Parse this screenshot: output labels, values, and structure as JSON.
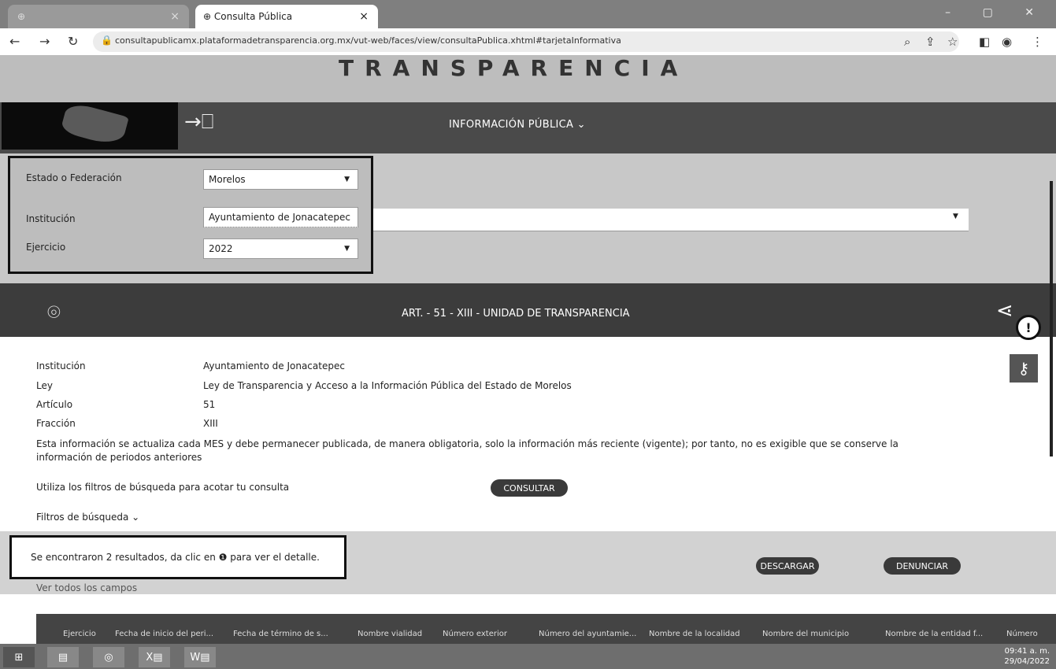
{
  "browser": {
    "tabs": [
      {
        "label": "",
        "active": false
      },
      {
        "label": "Consulta Pública",
        "active": true
      }
    ],
    "tab_close": "×",
    "url": "consultapublicamx.plataformadetransparencia.org.mx/vut-web/faces/view/consultaPublica.xhtml#tarjetaInformativa"
  },
  "header": {
    "logo_text": "TRANSPARENCIA",
    "nav_label": "INFORMACIÓN PÚBLICA ⌄"
  },
  "filters": {
    "state_label": "Estado o Federación",
    "state_value": "Morelos",
    "institution_label": "Institución",
    "institution_value": "Ayuntamiento de Jonacatepec",
    "year_label": "Ejercicio",
    "year_value": "2022"
  },
  "article": {
    "title": "ART. - 51 - XIII - UNIDAD DE TRANSPARENCIA"
  },
  "details": {
    "rows": [
      {
        "label": "Institución",
        "value": "Ayuntamiento de Jonacatepec"
      },
      {
        "label": "Ley",
        "value": "Ley de Transparencia y Acceso a la Información Pública del Estado de Morelos"
      },
      {
        "label": "Artículo",
        "value": "51"
      },
      {
        "label": "Fracción",
        "value": "XIII"
      }
    ],
    "note": "Esta información se actualiza cada MES y debe permanecer publicada, de manera obligatoria, solo la información más reciente (vigente); por tanto, no es exigible que se conserve la información de periodos anteriores",
    "hint": "Utiliza los filtros de búsqueda para acotar tu consulta",
    "consult_button": "CONSULTAR",
    "filters_toggle": "Filtros de búsqueda ⌄"
  },
  "results": {
    "message": "Se encontraron 2 resultados, da clic en ❶ para ver el detalle.",
    "download_button": "DESCARGAR",
    "report_button": "DENUNCIAR",
    "see_all": "Ver todos los campos"
  },
  "table": {
    "headers": [
      "Ejercicio",
      "Fecha de inicio del peri...",
      "Fecha de término de s...",
      "Nombre vialidad",
      "Número exterior",
      "Número del ayuntamie...",
      "Nombre de la localidad",
      "Nombre del municipio",
      "Nombre de la entidad f...",
      "Número"
    ]
  },
  "taskbar": {
    "time": "09:41 a. m.",
    "date": "29/04/2022"
  }
}
